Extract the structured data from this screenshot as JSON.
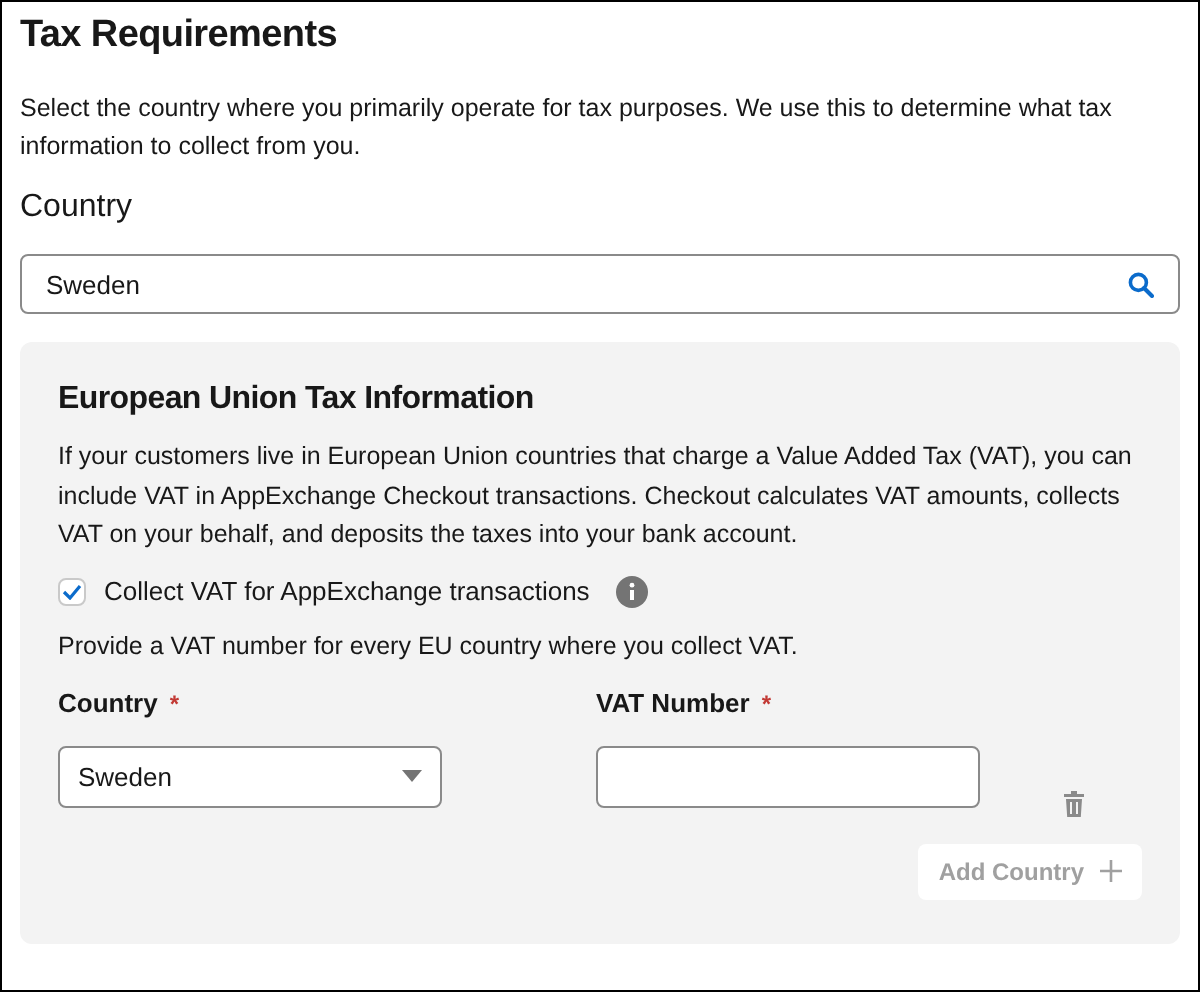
{
  "title": "Tax Requirements",
  "description": "Select the country where you primarily operate for tax purposes. We use this to determine what tax information to collect from you.",
  "country_search": {
    "label": "Country",
    "value": "Sweden"
  },
  "eu_panel": {
    "title": "European Union Tax Information",
    "description": "If your customers live in European Union countries that charge a Value Added Tax (VAT), you can include VAT in AppExchange Checkout transactions. Checkout calculates VAT amounts, collects VAT on your behalf, and deposits the taxes into your bank account.",
    "collect_vat": {
      "label": "Collect VAT for AppExchange transactions",
      "checked": true
    },
    "instruction": "Provide a VAT number for every EU country where you collect VAT.",
    "fields": [
      {
        "kind": "select",
        "label": "Country",
        "required_mark": "*",
        "value": "Sweden"
      },
      {
        "kind": "text",
        "label": "VAT Number",
        "required_mark": "*"
      }
    ],
    "add_button": {
      "label": "Add Country",
      "disabled": true
    }
  }
}
